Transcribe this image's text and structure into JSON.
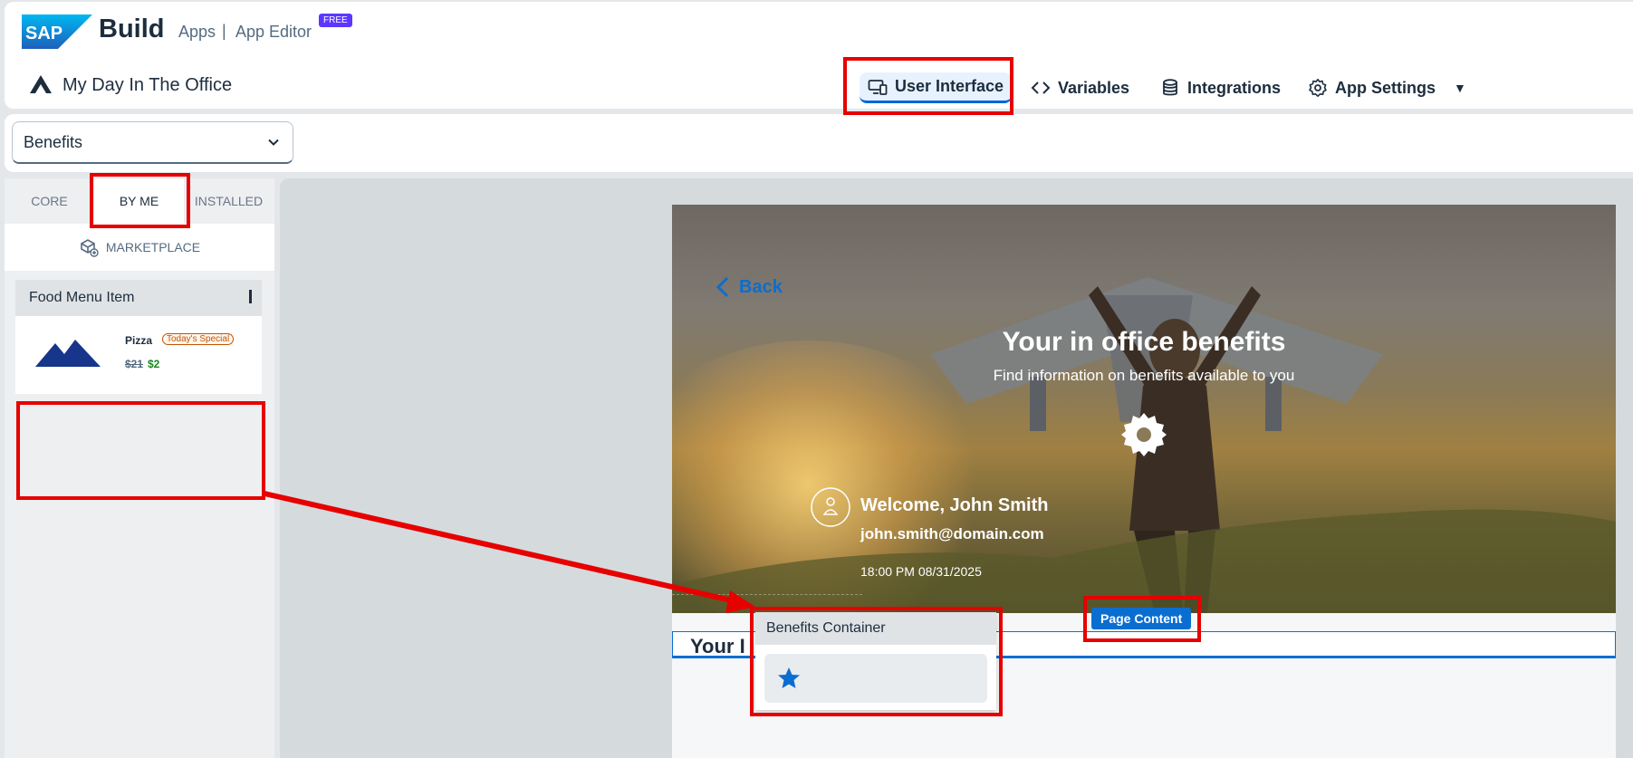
{
  "header": {
    "brand_logo_text": "SAP",
    "brand_build": "Build",
    "brand_apps": "Apps",
    "brand_separator": "|",
    "brand_editor": "App Editor",
    "free_badge": "FREE",
    "app_name": "My Day In The Office",
    "nav": {
      "user_interface": "User Interface",
      "variables": "Variables",
      "integrations": "Integrations",
      "app_settings": "App Settings"
    }
  },
  "toolbar": {
    "page_select_value": "Benefits"
  },
  "left_panel": {
    "tabs": [
      "CORE",
      "BY ME",
      "INSTALLED"
    ],
    "active_tab": "BY ME",
    "marketplace_label": "MARKETPLACE",
    "component_card": {
      "title": "Food Menu Item",
      "item_name": "Pizza",
      "badge": "Today's Special",
      "old_price": "$21",
      "new_price": "$2"
    }
  },
  "canvas": {
    "back_label": "Back",
    "hero_title": "Your in office benefits",
    "hero_subtitle": "Find information on benefits available to you",
    "welcome": "Welcome, John Smith",
    "email": "john.smith@domain.com",
    "datetime": "18:00 PM 08/31/2025",
    "section_title": "Your I",
    "page_content_badge": "Page Content"
  },
  "dragged_component": {
    "title": "Benefits Container"
  },
  "colors": {
    "accent": "#0a6ed1",
    "annotation_red": "#e60000",
    "sap_blue": "#1a8fd8",
    "free_badge": "#5d36ff"
  },
  "icons": {
    "user_interface": "monitor-phone-icon",
    "variables": "code-brackets-icon",
    "integrations": "database-icon",
    "app_settings": "gear-icon",
    "marketplace": "box-plus-icon",
    "back": "chevron-left-icon",
    "hero": "gear-icon",
    "avatar": "person-circle-icon",
    "benefits": "star-icon"
  }
}
